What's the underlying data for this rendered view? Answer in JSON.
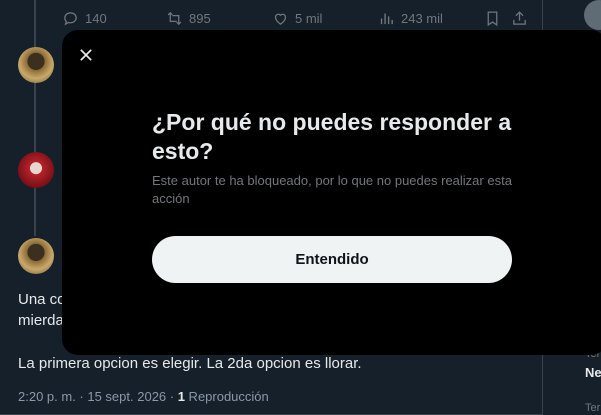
{
  "tweet_actions": {
    "replies": "140",
    "retweets": "895",
    "likes": "5 mil",
    "views": "243 mil"
  },
  "post": {
    "line1_fragment": "Una co",
    "line2_fragment": "mierda",
    "text": "La primera opcion es elegir. La 2da opcion es llorar.",
    "timestamp": "2:20 p. m. · 15 sept. 2026 · ",
    "reproductions_count": "1",
    "reproductions_label": " Reproducción"
  },
  "sidebar": {
    "fragment_top": "Ter",
    "fragment_bold": "Ne",
    "fragment_bottom": "Ter"
  },
  "modal": {
    "title": "¿Por qué no puedes responder a esto?",
    "body": "Este autor te ha bloqueado, por lo que no puedes realizar esta acción",
    "confirm_label": "Entendido"
  },
  "icons": {
    "close": "close-icon",
    "reply": "reply-icon",
    "retweet": "retweet-icon",
    "like": "heart-icon",
    "views": "views-icon",
    "bookmark": "bookmark-icon",
    "share": "share-icon"
  },
  "colors": {
    "background": "#15202b",
    "modal": "#000000",
    "button_bg": "#eff3f4",
    "muted": "#71767b"
  }
}
